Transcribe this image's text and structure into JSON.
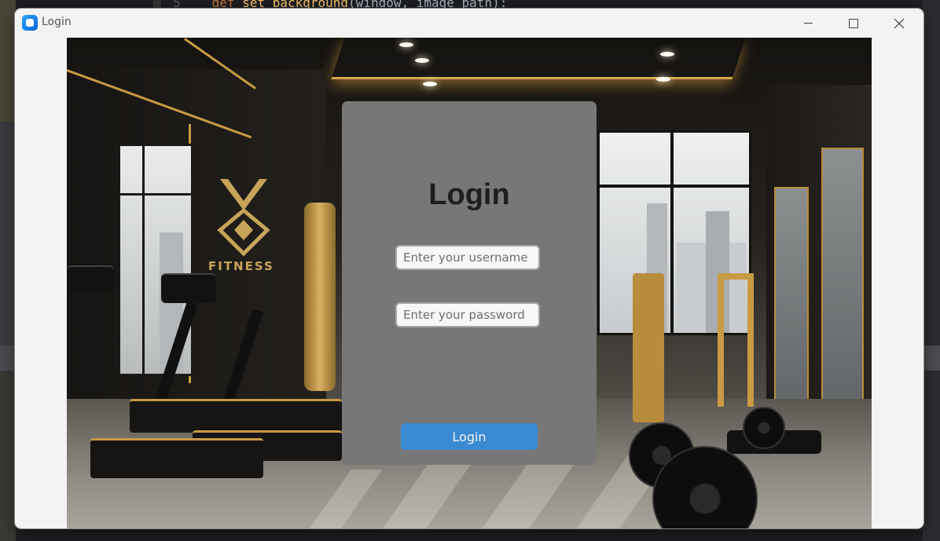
{
  "editor": {
    "line_number": "5",
    "code_kw": "def",
    "code_fn": "set_background",
    "code_rest": "(window, image_path):"
  },
  "window": {
    "title": "Login",
    "icon": "app-icon"
  },
  "background": {
    "logo_text": "FITNESS"
  },
  "login": {
    "title": "Login",
    "username_placeholder": "Enter your username",
    "username_value": "",
    "password_placeholder": "Enter your password",
    "password_value": "",
    "button_label": "Login"
  },
  "colors": {
    "panel": "#777777",
    "button": "#3a8ad3",
    "accent_gold": "#c99a44"
  }
}
